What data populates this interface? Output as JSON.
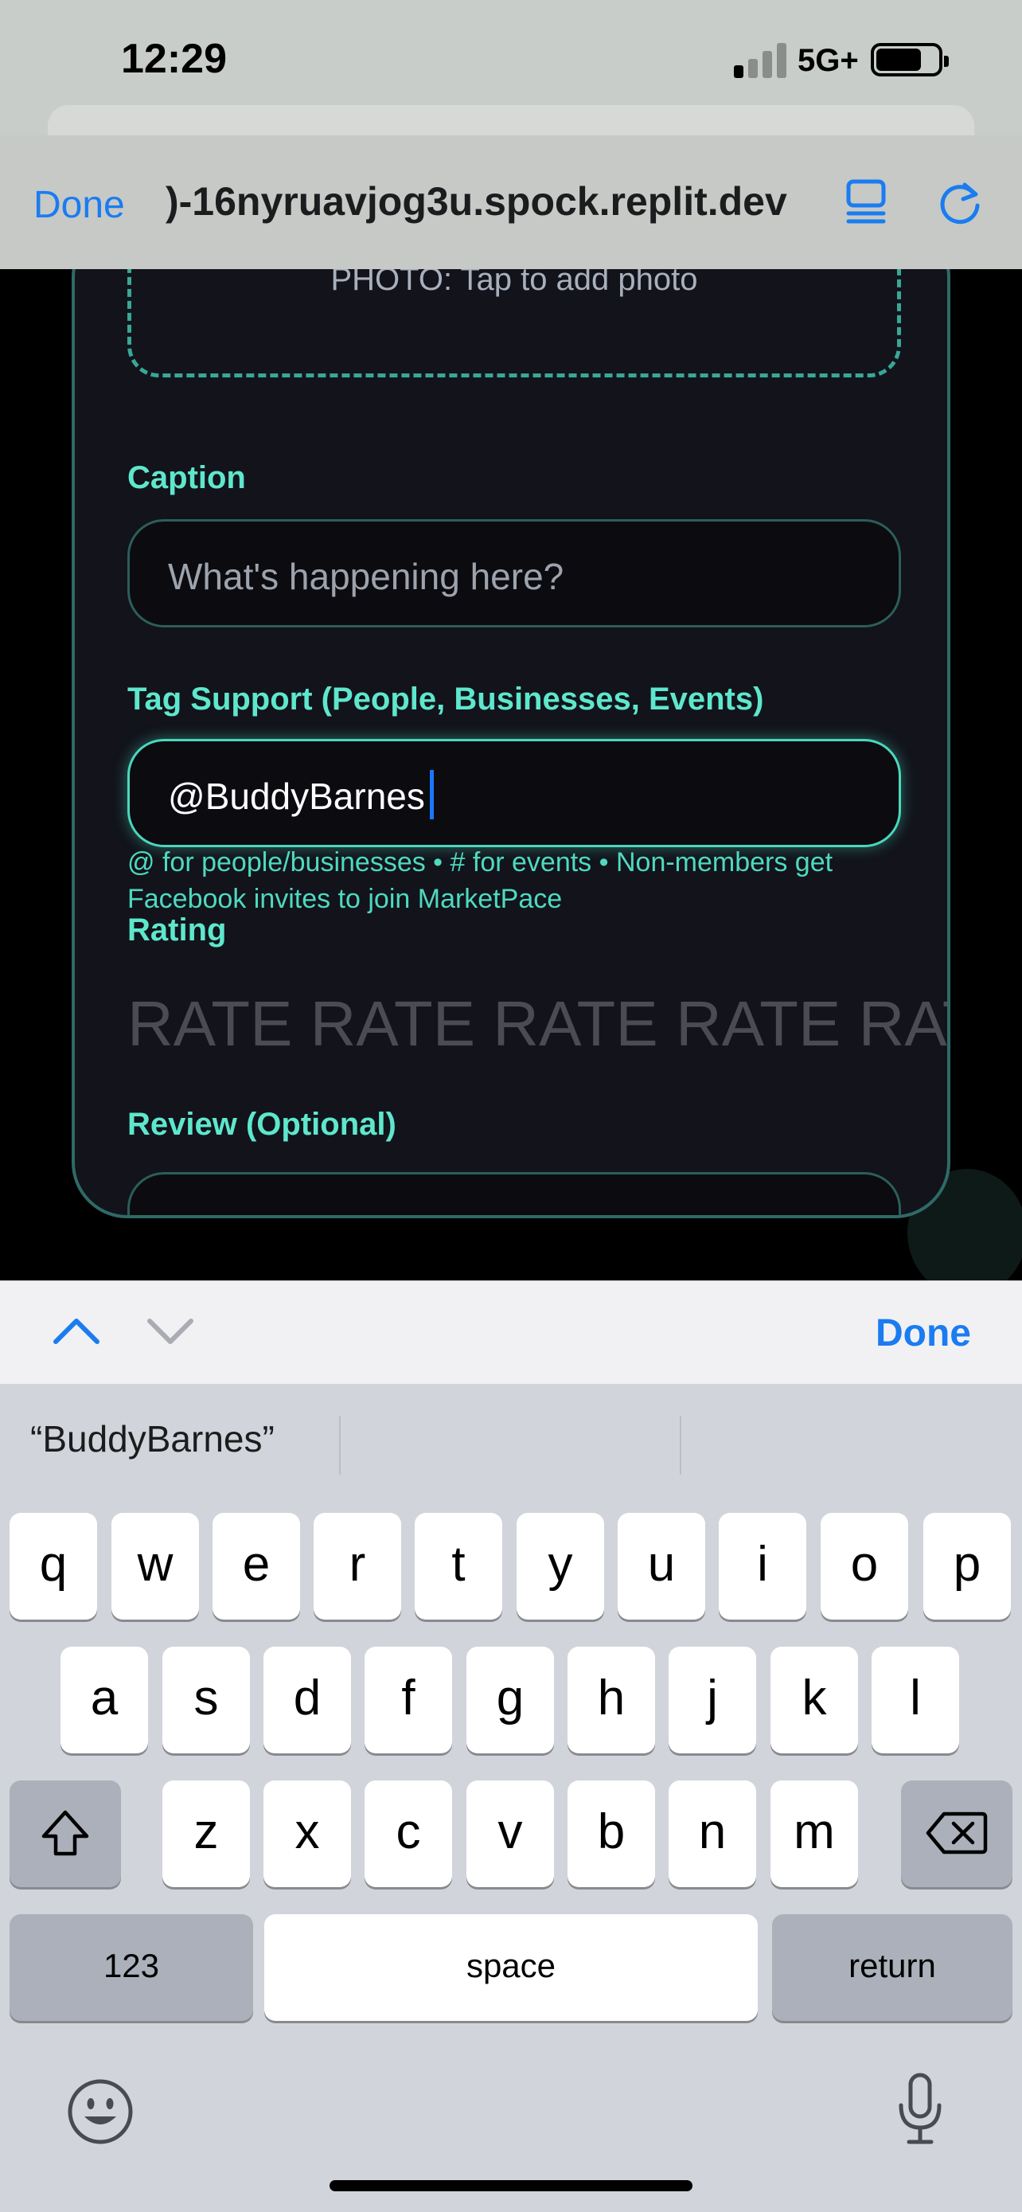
{
  "status_bar": {
    "time": "12:29",
    "network": "5G+"
  },
  "browser": {
    "done_label": "Done",
    "url": ")-16nyruavjog3u.spock.replit.dev",
    "accent_color": "#1a7cf0"
  },
  "form": {
    "photo_prompt": "PHOTO: Tap to add photo",
    "caption_label": "Caption",
    "caption_placeholder": "What's happening here?",
    "tag_label": "Tag Support (People, Businesses, Events)",
    "tag_value": "@BuddyBarnes",
    "tag_hint": "@ for people/businesses • # for events • Non-members get Facebook invites to join MarketPace",
    "rating_label": "Rating",
    "rating_text": "RATE RATE RATE RATE RATE",
    "review_label": "Review (Optional)",
    "accent_color": "#5ee7cc"
  },
  "keyboard": {
    "accessory_done": "Done",
    "suggestion": "“BuddyBarnes”",
    "row1": [
      "q",
      "w",
      "e",
      "r",
      "t",
      "y",
      "u",
      "i",
      "o",
      "p"
    ],
    "row2": [
      "a",
      "s",
      "d",
      "f",
      "g",
      "h",
      "j",
      "k",
      "l"
    ],
    "row3": [
      "z",
      "x",
      "c",
      "v",
      "b",
      "n",
      "m"
    ],
    "numbers_label": "123",
    "space_label": "space",
    "return_label": "return"
  }
}
